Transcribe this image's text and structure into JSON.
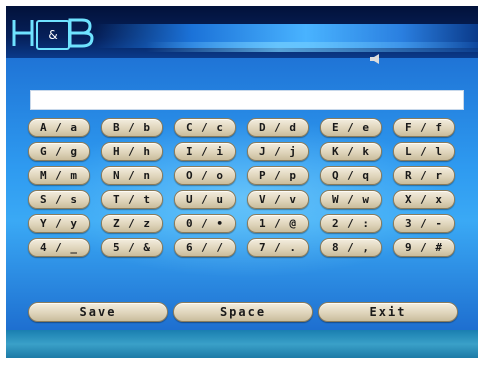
{
  "header": {
    "logo_text_left": "H",
    "logo_text_mid": "&",
    "logo_text_right": "B"
  },
  "status": {
    "speaker_icon": "speaker-icon",
    "battery_icon": "battery-icon"
  },
  "input": {
    "value": ""
  },
  "keys": [
    [
      "A / a",
      "B / b",
      "C / c",
      "D / d",
      "E / e",
      "F / f"
    ],
    [
      "G / g",
      "H / h",
      "I / i",
      "J / j",
      "K / k",
      "L / l"
    ],
    [
      "M / m",
      "N / n",
      "O / o",
      "P / p",
      "Q / q",
      "R / r"
    ],
    [
      "S / s",
      "T / t",
      "U / u",
      "V / v",
      "W / w",
      "X / x"
    ],
    [
      "Y / y",
      "Z / z",
      "0 / •",
      "1 / @",
      "2 / :",
      "3 / -"
    ],
    [
      "4 / _",
      "5 / &",
      "6 / /",
      "7 / .",
      "8 / ,",
      "9 / #"
    ]
  ],
  "actions": {
    "save": "Save",
    "space": "Space",
    "exit": "Exit"
  }
}
